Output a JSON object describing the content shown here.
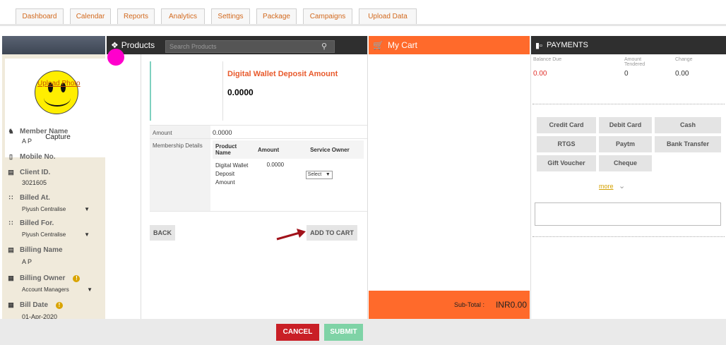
{
  "nav": {
    "tabs": [
      "Dashboard",
      "Calendar",
      "Reports",
      "Analytics",
      "Settings",
      "Package",
      "Campaigns",
      "Upload Data"
    ]
  },
  "sidebar": {
    "upload_photo": "Upload Photo",
    "capture": "Capture",
    "member_name_label": "Member Name",
    "member_name": "A P",
    "mobile_label": "Mobile No.",
    "client_id_label": "Client ID.",
    "client_id": "3021605",
    "billed_at_label": "Billed At.",
    "billed_at": "Piyush Centralise",
    "billed_for_label": "Billed For.",
    "billed_for": "Piyush Centralise",
    "billing_name_label": "Billing Name",
    "billing_name": "A P",
    "billing_owner_label": "Billing Owner",
    "billing_owner": "Account Managers",
    "bill_date_label": "Bill Date",
    "bill_date": "01-Apr-2020",
    "info_glyph": "!"
  },
  "products": {
    "title": "Products",
    "search_placeholder": "Search Products",
    "product_name": "Digital Wallet Deposit Amount",
    "product_amount": "0.0000",
    "amount_label": "Amount",
    "amount_value": "0.0000",
    "membership_label": "Membership Details",
    "table_headers": {
      "name": "Product Name",
      "amount": "Amount",
      "owner": "Service Owner"
    },
    "row": {
      "name": "Digital Wallet Deposit Amount",
      "amount": "0.0000",
      "owner_select": "Select"
    },
    "back": "BACK",
    "add_to_cart": "ADD TO CART"
  },
  "cart": {
    "title": "My Cart",
    "subtotal_label": "Sub-Total :",
    "subtotal_value": "INR0.00"
  },
  "payments": {
    "title": "PAYMENTS",
    "balance_due_label": "Balance Due",
    "balance_due": "0.00",
    "amount_tendered_label": "Amount Tendered",
    "amount_tendered": "0",
    "change_label": "Change",
    "change": "0.00",
    "methods": [
      "Credit Card",
      "Debit Card",
      "Cash",
      "RTGS",
      "Paytm",
      "Bank Transfer",
      "Gift Voucher",
      "Cheque"
    ],
    "more": "more"
  },
  "footer": {
    "cancel": "CANCEL",
    "submit": "SUBMIT"
  },
  "colors": {
    "accent_orange": "#ff6a2b",
    "cancel_red": "#c91f26",
    "submit_green": "#7fd3a6",
    "title_orange": "#e85a2c"
  }
}
